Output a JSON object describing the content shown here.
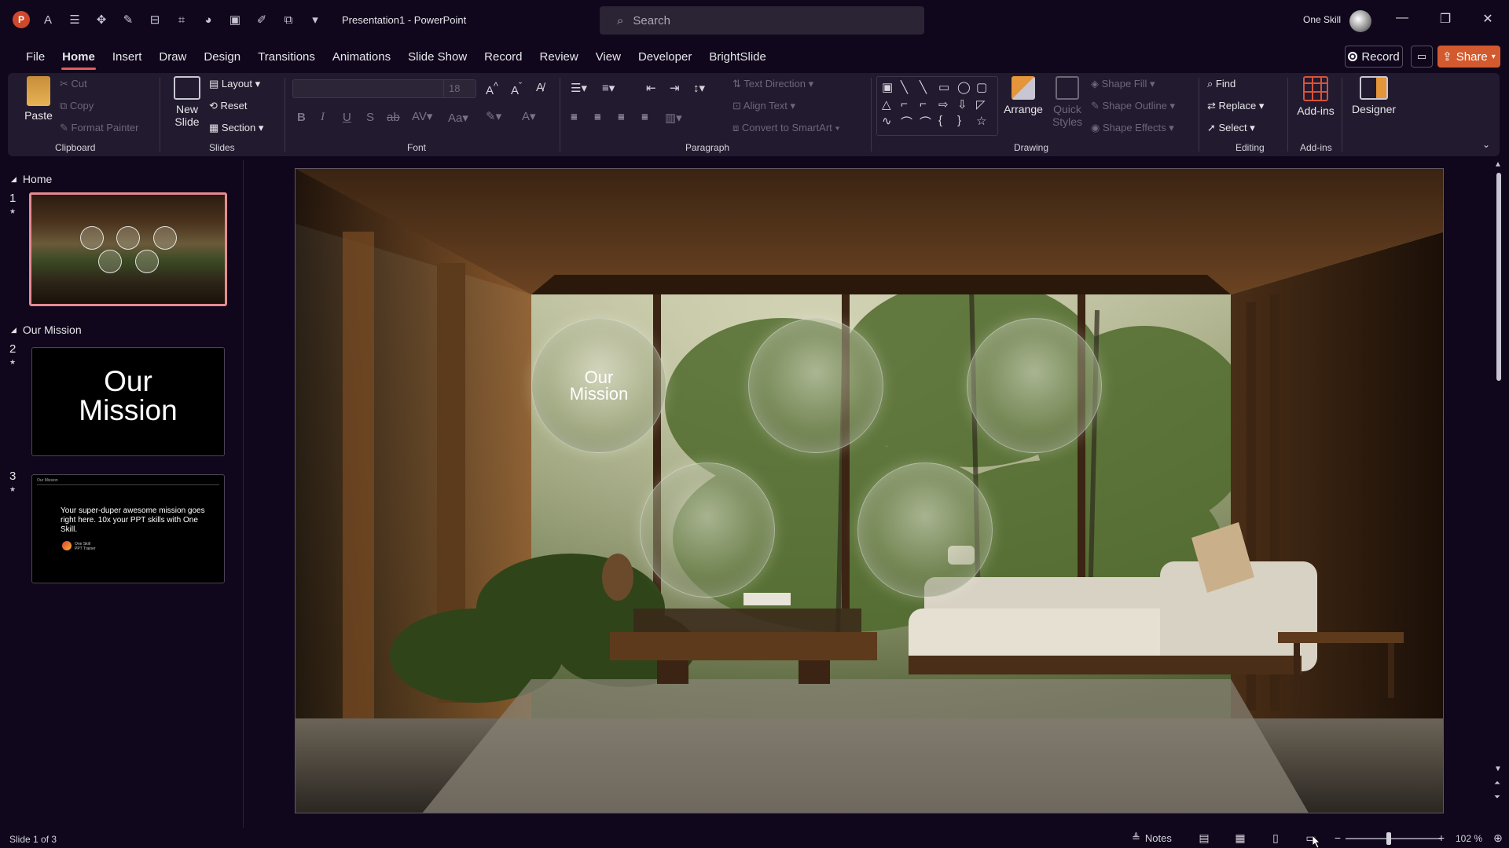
{
  "app": {
    "doc_title": "Presentation1  -  PowerPoint",
    "search_placeholder": "Search",
    "user_name": "One Skill"
  },
  "menu_tabs": [
    "File",
    "Home",
    "Insert",
    "Draw",
    "Design",
    "Transitions",
    "Animations",
    "Slide Show",
    "Record",
    "Review",
    "View",
    "Developer",
    "BrightSlide"
  ],
  "header_actions": {
    "record": "Record",
    "share": "Share"
  },
  "ribbon": {
    "clipboard": {
      "label": "Clipboard",
      "paste": "Paste",
      "cut": "Cut",
      "copy": "Copy",
      "format_painter": "Format Painter"
    },
    "slides": {
      "label": "Slides",
      "new_slide": "New Slide",
      "layout": "Layout",
      "reset": "Reset",
      "section": "Section"
    },
    "font": {
      "label": "Font",
      "font_name": "",
      "font_size": "18"
    },
    "paragraph": {
      "label": "Paragraph",
      "text_direction": "Text Direction",
      "align_text": "Align Text",
      "convert_smartart": "Convert to SmartArt"
    },
    "drawing": {
      "label": "Drawing",
      "arrange": "Arrange",
      "quick_styles": "Quick Styles",
      "shape_fill": "Shape Fill",
      "shape_outline": "Shape Outline",
      "shape_effects": "Shape Effects"
    },
    "editing": {
      "label": "Editing",
      "find": "Find",
      "replace": "Replace",
      "select": "Select"
    },
    "addins": {
      "label": "Add-ins",
      "addins_btn": "Add-ins"
    },
    "designer": {
      "label": "Designer"
    }
  },
  "slide_panel": {
    "sections": [
      {
        "name": "Home"
      },
      {
        "name": "Our Mission"
      }
    ],
    "slides": [
      {
        "num": "1"
      },
      {
        "num": "2",
        "title": "Our Mission"
      },
      {
        "num": "3",
        "header": "Our Mission",
        "text": "Your super-duper awesome mission goes right here. 10x your PPT skills with One Skill.",
        "small": "One Skill\nPPT Trainer"
      }
    ]
  },
  "slide_canvas": {
    "circle_label": "Our\nMission",
    "circle_count": 5
  },
  "status_bar": {
    "slide_count": "Slide 1 of 3",
    "notes": "Notes",
    "zoom": "102 %"
  },
  "colors": {
    "background": "#10071c",
    "ribbon": "#221a2e",
    "accent": "#e65c5c",
    "share": "#d35a2e"
  }
}
